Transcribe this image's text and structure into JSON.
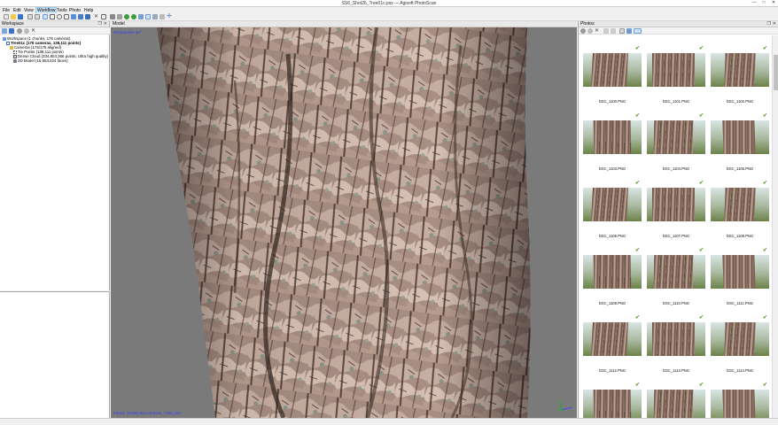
{
  "window": {
    "title": "SS6_Shot26_Tree01c.psx — Agisoft PhotoScan",
    "controls": [
      "—",
      "□",
      "✕"
    ]
  },
  "menu": [
    {
      "label": "File",
      "active": false
    },
    {
      "label": "Edit",
      "active": false
    },
    {
      "label": "View",
      "active": false
    },
    {
      "label": "Workflow",
      "active": true
    },
    {
      "label": "Tools",
      "active": false
    },
    {
      "label": "Photo",
      "active": false
    },
    {
      "label": "Help",
      "active": false
    }
  ],
  "workspace": {
    "title": "Workspace",
    "tree": [
      {
        "text": "Workspace (1 chunks, 175 cameras)",
        "icon": "workspace-icon",
        "bold": false
      },
      {
        "text": "Tree01c (175 cameras, 138,111 points)",
        "icon": "chunk-icon",
        "bold": true
      },
      {
        "text": "Cameras (175/175 aligned)",
        "icon": "cameras-folder-icon",
        "bold": false
      },
      {
        "text": "Tie Points (138,111 points)",
        "icon": "tie-points-icon",
        "bold": false
      },
      {
        "text": "Dense Cloud (234,804,366 points, Ultra high quality)",
        "icon": "dense-cloud-icon",
        "bold": false
      },
      {
        "text": "3D Model (15,653,624 faces)",
        "icon": "model-icon",
        "bold": false
      }
    ]
  },
  "model": {
    "title": "Model",
    "projection": "Perspective 30°",
    "stats": "Faces: 15,653,624 vertices: 7,861,107"
  },
  "photos": {
    "title": "Photos",
    "items": [
      {
        "name": "DSC_1100.PNG"
      },
      {
        "name": "DSC_1101.PNG"
      },
      {
        "name": "DSC_1102.PNG"
      },
      {
        "name": "DSC_1103.PNG"
      },
      {
        "name": "DSC_1104.PNG"
      },
      {
        "name": "DSC_1105.PNG"
      },
      {
        "name": "DSC_1106.PNG"
      },
      {
        "name": "DSC_1107.PNG"
      },
      {
        "name": "DSC_1108.PNG"
      },
      {
        "name": "DSC_1109.PNG"
      },
      {
        "name": "DSC_1110.PNG"
      },
      {
        "name": "DSC_1111.PNG"
      },
      {
        "name": "DSC_1112.PNG"
      },
      {
        "name": "DSC_1113.PNG"
      },
      {
        "name": "DSC_1114.PNG"
      },
      {
        "name": ""
      },
      {
        "name": ""
      },
      {
        "name": ""
      }
    ]
  },
  "colors": {
    "accent_check": "#5ca02a",
    "viewport_bg": "#7a7a7a",
    "overlay_text": "#2d3cff"
  }
}
